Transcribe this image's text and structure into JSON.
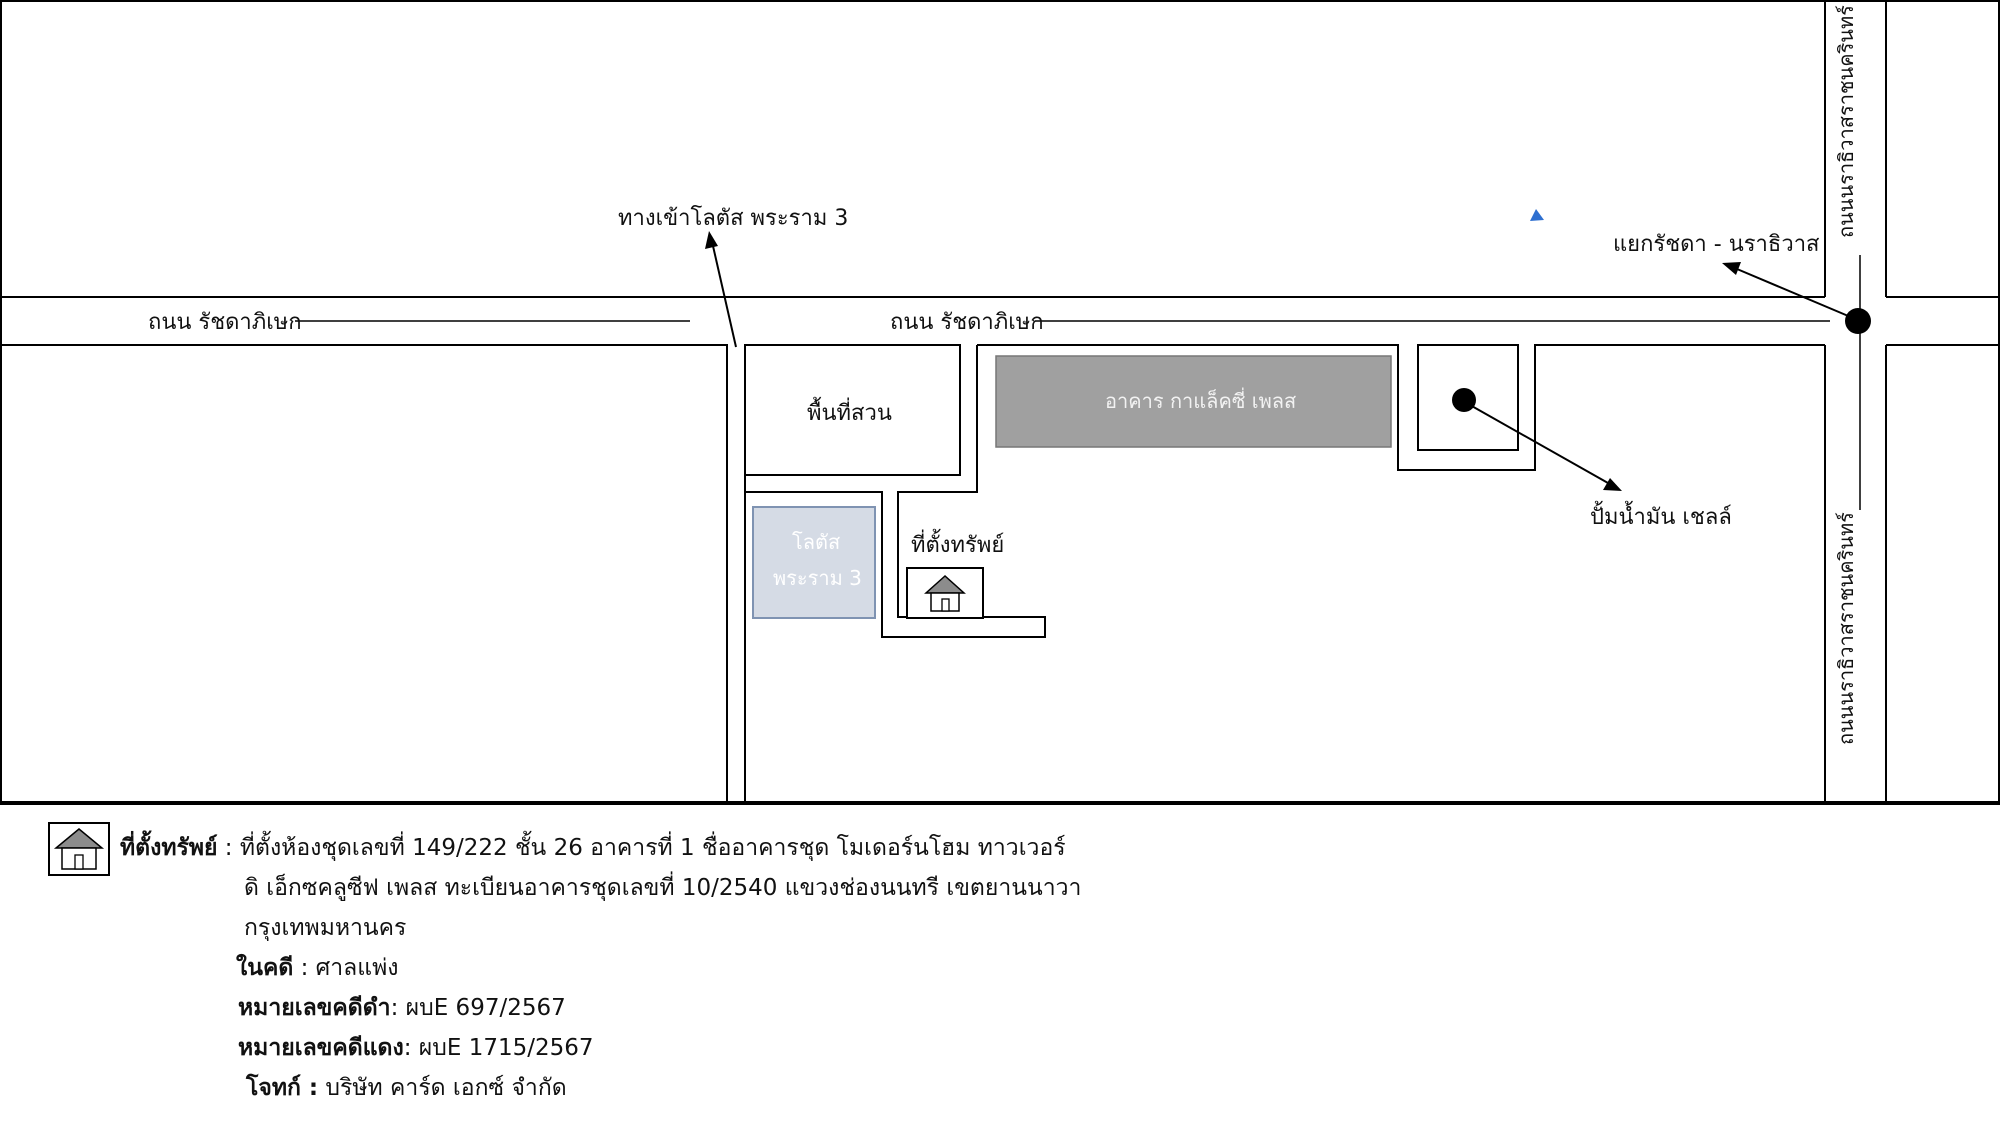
{
  "map": {
    "labels": {
      "road_main_left": "ถนน รัชดาภิเษก",
      "road_main_mid": "ถนน รัชดาภิเษก",
      "lotus_entrance": "ทางเข้าโลตัส พระราม 3",
      "intersection": "แยกรัชดา - นราธิวาส",
      "road_vertical_top": "ถนนนราธิวาสราชนครินทร์",
      "road_vertical_bottom": "ถนนนราธิวาสราชนครินทร์",
      "garden": "พื้นที่สวน",
      "galaxy_building": "อาคาร กาแล็คซี่ เพลส",
      "lotus_line1": "โลตัส",
      "lotus_line2": "พระราม 3",
      "property_location": "ที่ตั้งทรัพย์",
      "shell_station": "ปั้มน้ำมัน เชลล์"
    },
    "colors": {
      "galaxy_fill": "#a0a0a0",
      "lotus_fill": "#d5dbe5",
      "lotus_border": "#7f93b2",
      "marker": "#2e6fd0",
      "line": "#000000"
    }
  },
  "legend": {
    "icon": "house-icon",
    "property_heading": "ที่ตั้งทรัพย์",
    "property_text_1": " : ที่ตั้งห้องชุดเลขที่ 149/222 ชั้น 26 อาคารที่ 1 ชื่ออาคารชุด โมเดอร์นโฮม ทาวเวอร์",
    "property_text_2": "ดิ เอ็กซคลูซีฟ เพลส ทะเบียนอาคารชุดเลขที่ 10/2540 แขวงช่องนนทรี เขตยานนาวา",
    "property_text_3": "กรุงเทพมหานคร",
    "case_label": "ในคดี",
    "case_value": " : ศาลแพ่ง",
    "black_case_label": "หมายเลขคดีดำ",
    "black_case_value": ": ผบE 697/2567",
    "red_case_label": "หมายเลขคดีแดง",
    "red_case_value": ": ผบE 1715/2567",
    "plaintiff_label": "โจทก์ :",
    "plaintiff_value": " บริษัท คาร์ด เอกซ์ จำกัด"
  }
}
